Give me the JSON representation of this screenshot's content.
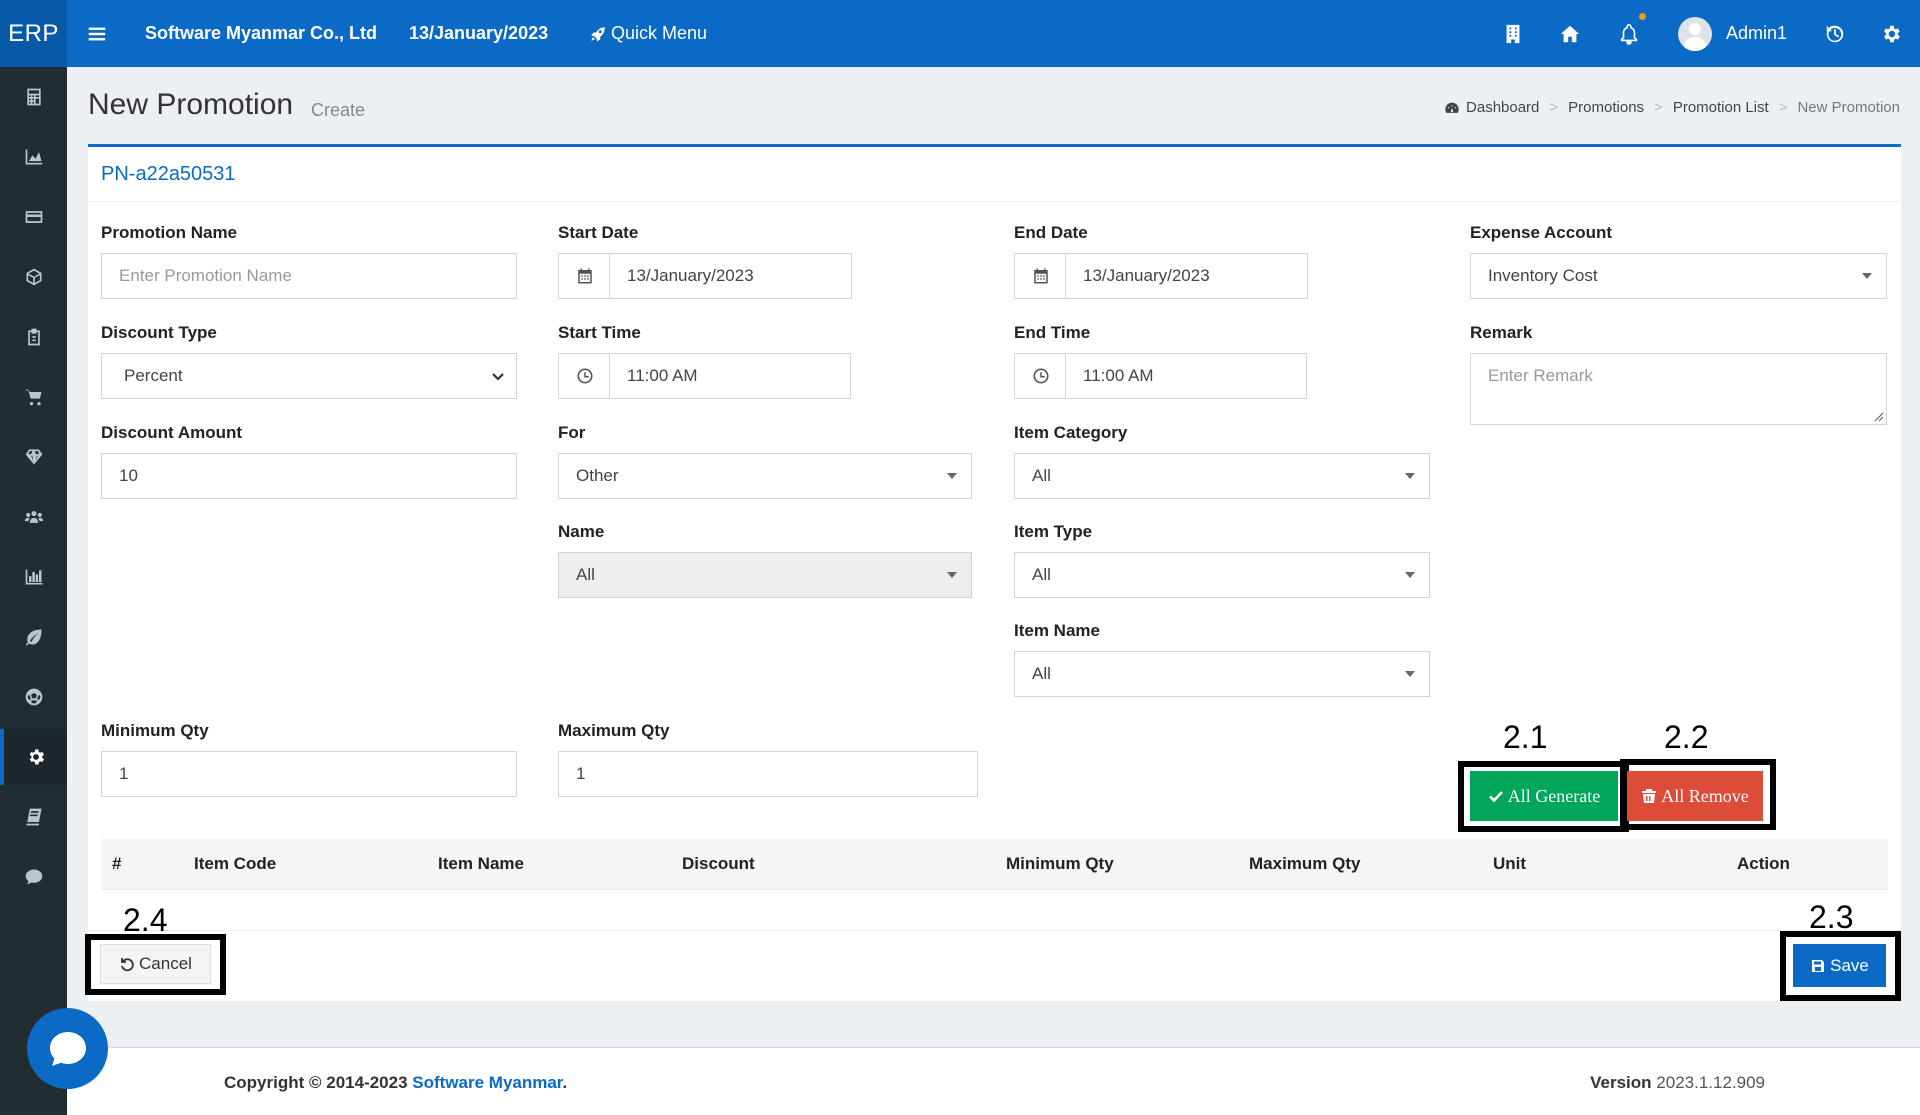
{
  "app": {
    "logo": "ERP",
    "company": "Software Myanmar Co., Ltd",
    "date": "13/January/2023",
    "quick_menu": "Quick Menu",
    "user": "Admin1"
  },
  "sidebar": {
    "items": [
      "calculator-icon",
      "area-chart-icon",
      "credit-card-icon",
      "cube-icon",
      "clipboard-icon",
      "cart-icon",
      "diamond-icon",
      "users-icon",
      "bar-chart-icon",
      "leaf-icon",
      "futbol-icon",
      "gear-icon",
      "book-icon",
      "comment-icon"
    ],
    "active": "gear-icon"
  },
  "header": {
    "title": "New Promotion",
    "subtitle": "Create"
  },
  "breadcrumb": {
    "items": [
      "Dashboard",
      "Promotions",
      "Promotion List"
    ],
    "current": "New Promotion"
  },
  "form": {
    "code": "PN-a22a50531",
    "promotion_name": {
      "label": "Promotion Name",
      "placeholder": "Enter Promotion Name"
    },
    "start_date": {
      "label": "Start Date",
      "value": "13/January/2023"
    },
    "end_date": {
      "label": "End Date",
      "value": "13/January/2023"
    },
    "expense_account": {
      "label": "Expense Account",
      "value": "Inventory Cost"
    },
    "discount_type": {
      "label": "Discount Type",
      "value": "Percent"
    },
    "start_time": {
      "label": "Start Time",
      "value": "11:00 AM"
    },
    "end_time": {
      "label": "End Time",
      "value": "11:00 AM"
    },
    "remark": {
      "label": "Remark",
      "placeholder": "Enter Remark"
    },
    "discount_amount": {
      "label": "Discount Amount",
      "value": "10"
    },
    "for": {
      "label": "For",
      "value": "Other"
    },
    "item_category": {
      "label": "Item Category",
      "value": "All"
    },
    "name": {
      "label": "Name",
      "value": "All"
    },
    "item_type": {
      "label": "Item Type",
      "value": "All"
    },
    "item_name": {
      "label": "Item Name",
      "value": "All"
    },
    "minimum_qty": {
      "label": "Minimum Qty",
      "value": "1"
    },
    "maximum_qty": {
      "label": "Maximum Qty",
      "value": "1"
    }
  },
  "buttons": {
    "all_generate": "All Generate",
    "all_remove": "All Remove",
    "cancel": "Cancel",
    "save": "Save"
  },
  "annotations": {
    "generate": "2.1",
    "remove": "2.2",
    "save": "2.3",
    "cancel": "2.4"
  },
  "table": {
    "columns": [
      "#",
      "Item Code",
      "Item Name",
      "Discount",
      "Minimum Qty",
      "Maximum Qty",
      "Unit",
      "Action"
    ]
  },
  "footer": {
    "copyright_prefix": "Copyright © 2014-2023 ",
    "brand": "Software Myanmar",
    "copyright_suffix": ".",
    "version_label": "Version",
    "version": "2023.1.12.909"
  },
  "colors": {
    "primary": "#0a6ac6",
    "sidebar": "#222d32",
    "success": "#00a65a",
    "danger": "#dd4b39"
  }
}
